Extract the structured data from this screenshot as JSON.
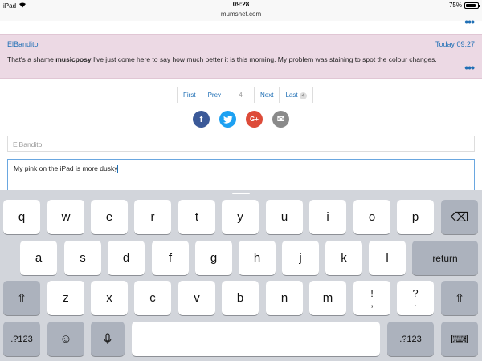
{
  "status": {
    "device": "iPad",
    "time": "09:28",
    "battery": "75%",
    "battery_level": 0.75
  },
  "browser": {
    "url": "mumsnet.com"
  },
  "post": {
    "author": "ElBandito",
    "time": "Today 09:27",
    "text_before": "That's a shame ",
    "mention": "musicposy",
    "text_after": " I've just come here to say how much better it is this morning. My problem was staining to spot the colour changes."
  },
  "pagination": {
    "first": "First",
    "prev": "Prev",
    "current": "4",
    "next": "Next",
    "last": "Last",
    "last_count": "4"
  },
  "share": {
    "facebook": "f",
    "twitter": "t",
    "googleplus": "G+",
    "email": "✉"
  },
  "form": {
    "name_value": "ElBandito",
    "message": "My pink on the iPad is more dusky"
  },
  "keyboard": {
    "row1": [
      "q",
      "w",
      "e",
      "r",
      "t",
      "y",
      "u",
      "i",
      "o",
      "p"
    ],
    "row2": [
      "a",
      "s",
      "d",
      "f",
      "g",
      "h",
      "j",
      "k",
      "l"
    ],
    "row3": [
      "z",
      "x",
      "c",
      "v",
      "b",
      "n",
      "m"
    ],
    "return": "return",
    "numbers": ".?123",
    "punct1_top": "!",
    "punct1_bottom": ",",
    "punct2_top": "?",
    "punct2_bottom": ".",
    "emoji": "☺",
    "mic": "🎙",
    "shift": "⇧",
    "delete": "⌫",
    "hide": "⌨"
  }
}
